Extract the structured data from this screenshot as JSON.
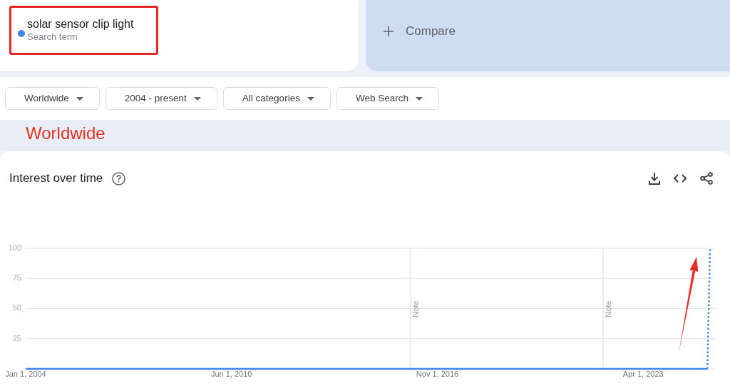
{
  "search_terms": [
    {
      "label": "solar sensor clip light",
      "sublabel": "Search term",
      "color": "#4285f4"
    }
  ],
  "compare": {
    "label": "Compare"
  },
  "filters": [
    {
      "label": "Worldwide"
    },
    {
      "label": "2004 - present"
    },
    {
      "label": "All categories"
    },
    {
      "label": "Web Search"
    }
  ],
  "annotation_text": "Worldwide",
  "interest_over_time": {
    "title": "Interest over time",
    "chart_data": {
      "type": "line",
      "grid": true,
      "categories": [
        "Jan 1, 2004",
        null,
        null,
        null,
        null,
        null,
        null,
        null,
        null,
        null,
        null,
        null,
        null,
        null,
        null,
        null,
        null,
        null,
        null,
        null,
        null,
        null,
        null,
        null,
        null,
        null,
        null,
        null,
        null,
        null,
        null,
        null,
        null,
        null,
        null,
        null,
        null,
        null,
        null,
        null,
        null,
        null,
        null,
        null,
        null,
        null,
        null,
        null,
        null,
        null,
        null,
        null,
        null,
        null,
        null,
        null,
        null,
        null,
        null,
        null,
        null,
        null,
        null,
        null,
        null,
        null,
        null,
        null,
        null,
        null,
        null,
        null,
        null,
        null,
        null,
        null,
        null,
        "Jun 1, 2010",
        null,
        null,
        null,
        null,
        null,
        null,
        null,
        null,
        null,
        null,
        null,
        null,
        null,
        null,
        null,
        null,
        null,
        null,
        null,
        null,
        null,
        null,
        null,
        null,
        null,
        null,
        null,
        null,
        null,
        null,
        null,
        null,
        null,
        null,
        null,
        null,
        null,
        null,
        null,
        null,
        null,
        null,
        null,
        null,
        null,
        null,
        null,
        null,
        null,
        null,
        null,
        null,
        null,
        null,
        null,
        null,
        null,
        null,
        null,
        null,
        null,
        null,
        null,
        null,
        null,
        null,
        null,
        null,
        null,
        null,
        null,
        null,
        null,
        null,
        null,
        null,
        "Nov 1, 2016",
        null,
        null,
        null,
        null,
        null,
        null,
        null,
        null,
        null,
        null,
        null,
        null,
        null,
        null,
        null,
        null,
        null,
        null,
        null,
        null,
        null,
        null,
        null,
        null,
        null,
        null,
        null,
        null,
        null,
        null,
        null,
        null,
        null,
        null,
        null,
        null,
        null,
        null,
        null,
        null,
        null,
        null,
        null,
        null,
        null,
        null,
        null,
        null,
        null,
        null,
        null,
        null,
        null,
        null,
        null,
        null,
        null,
        null,
        null,
        null,
        null,
        null,
        null,
        null,
        null,
        null,
        null,
        null,
        null,
        null,
        null,
        null,
        null,
        null,
        null,
        null,
        "Apr 1, 2023",
        null,
        null,
        null,
        null,
        null,
        null,
        null,
        null,
        null,
        null,
        null,
        null,
        null,
        null,
        null,
        null,
        null,
        null,
        null,
        null,
        null,
        null,
        null,
        null,
        null
      ],
      "ylim": [
        0,
        100
      ],
      "yticks": [
        25,
        50,
        75,
        100
      ],
      "series": [
        {
          "color": "#4285f4",
          "values": [
            0,
            0,
            0,
            0,
            0,
            0,
            0,
            0,
            0,
            0,
            0,
            0,
            0,
            0,
            0,
            0,
            0,
            0,
            0,
            0,
            0,
            0,
            0,
            0,
            0,
            0,
            0,
            0,
            0,
            0,
            0,
            0,
            0,
            0,
            0,
            0,
            0,
            0,
            0,
            0,
            0,
            0,
            0,
            0,
            0,
            0,
            0,
            0,
            0,
            0,
            0,
            0,
            0,
            0,
            0,
            0,
            0,
            0,
            0,
            0,
            0,
            0,
            0,
            0,
            0,
            0,
            0,
            0,
            0,
            0,
            0,
            0,
            0,
            0,
            0,
            0,
            0,
            0,
            0,
            0,
            0,
            0,
            0,
            0,
            0,
            0,
            0,
            0,
            0,
            0,
            0,
            0,
            0,
            0,
            0,
            0,
            0,
            0,
            0,
            0,
            0,
            0,
            0,
            0,
            0,
            0,
            0,
            0,
            0,
            0,
            0,
            0,
            0,
            0,
            0,
            0,
            0,
            0,
            0,
            0,
            0,
            0,
            0,
            0,
            0,
            0,
            0,
            0,
            0,
            0,
            0,
            0,
            0,
            0,
            0,
            0,
            0,
            0,
            0,
            0,
            0,
            0,
            0,
            0,
            0,
            0,
            0,
            0,
            0,
            0,
            0,
            0,
            0,
            0,
            0,
            0,
            0,
            0,
            0,
            0,
            0,
            0,
            0,
            0,
            0,
            0,
            0,
            0,
            0,
            0,
            0,
            0,
            0,
            0,
            0,
            0,
            0,
            0,
            0,
            0,
            0,
            0,
            0,
            0,
            0,
            0,
            0,
            0,
            0,
            0,
            0,
            0,
            0,
            0,
            0,
            0,
            0,
            0,
            0,
            0,
            0,
            0,
            0,
            0,
            0,
            0,
            0,
            0,
            0,
            0,
            0,
            0,
            0,
            0,
            0,
            0,
            0,
            0,
            0,
            0,
            0,
            0,
            0,
            0,
            0,
            0,
            0,
            0,
            0,
            0,
            0,
            0,
            0,
            0,
            0,
            0,
            0,
            0,
            0,
            0,
            0,
            0,
            0,
            0,
            0,
            0,
            0,
            0,
            0,
            0,
            0,
            0,
            0,
            0,
            0,
            0,
            100
          ]
        }
      ],
      "annotations": [
        "Note",
        "Note"
      ]
    }
  }
}
